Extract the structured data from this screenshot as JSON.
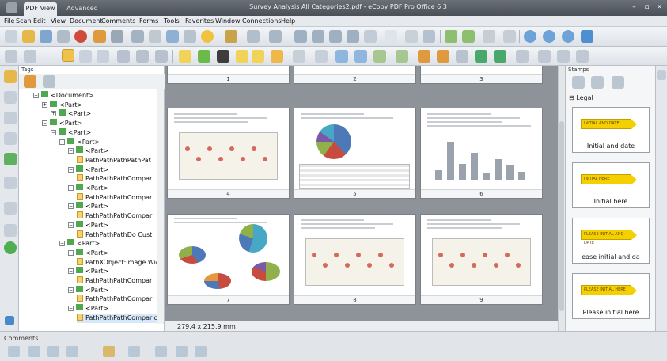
{
  "titlebar": {
    "tabs": [
      {
        "label": "PDF View"
      },
      {
        "label": "Advanced Edit"
      }
    ],
    "title": "Survey Analysis All Categories2.pdf - eCopy PDF Pro Office 6.3"
  },
  "menu": [
    "File",
    "Scan",
    "Edit",
    "View",
    "Document",
    "Comments",
    "Forms",
    "Tools",
    "Favorites",
    "Window",
    "Connections",
    "Help"
  ],
  "tags_panel": {
    "title": "Tags",
    "tree": [
      {
        "label": "<Document>",
        "depth": 0,
        "kind": "tag",
        "open": true
      },
      {
        "label": "<Part>",
        "depth": 1,
        "kind": "tag",
        "open": false
      },
      {
        "label": "<Part>",
        "depth": 2,
        "kind": "tag",
        "open": false
      },
      {
        "label": "<Part>",
        "depth": 1,
        "kind": "tag",
        "open": true
      },
      {
        "label": "<Part>",
        "depth": 2,
        "kind": "tag",
        "open": true
      },
      {
        "label": "<Part>",
        "depth": 3,
        "kind": "tag",
        "open": true
      },
      {
        "label": "<Part>",
        "depth": 4,
        "kind": "tag",
        "open": true
      },
      {
        "label": "PathPathPathPathPat",
        "depth": 5,
        "kind": "content"
      },
      {
        "label": "<Part>",
        "depth": 4,
        "kind": "tag",
        "open": true
      },
      {
        "label": "PathPathPathCompar",
        "depth": 5,
        "kind": "content"
      },
      {
        "label": "<Part>",
        "depth": 4,
        "kind": "tag",
        "open": true
      },
      {
        "label": "PathPathPathCompar",
        "depth": 5,
        "kind": "content"
      },
      {
        "label": "<Part>",
        "depth": 4,
        "kind": "tag",
        "open": true
      },
      {
        "label": "PathPathPathCompar",
        "depth": 5,
        "kind": "content"
      },
      {
        "label": "<Part>",
        "depth": 4,
        "kind": "tag",
        "open": true
      },
      {
        "label": "PathPathPathDo Cust",
        "depth": 5,
        "kind": "content"
      },
      {
        "label": "<Part>",
        "depth": 3,
        "kind": "tag",
        "open": true
      },
      {
        "label": "<Part>",
        "depth": 4,
        "kind": "tag",
        "open": true
      },
      {
        "label": "PathXObject:Image Width",
        "depth": 5,
        "kind": "content"
      },
      {
        "label": "<Part>",
        "depth": 4,
        "kind": "tag",
        "open": true
      },
      {
        "label": "PathPathPathCompar",
        "depth": 5,
        "kind": "content"
      },
      {
        "label": "<Part>",
        "depth": 4,
        "kind": "tag",
        "open": true
      },
      {
        "label": "PathPathPathCompar",
        "depth": 5,
        "kind": "content"
      },
      {
        "label": "<Part>",
        "depth": 4,
        "kind": "tag",
        "open": true
      },
      {
        "label": "PathPathPathComparions",
        "depth": 5,
        "kind": "content",
        "selected": true
      }
    ]
  },
  "pages": [
    {
      "num": "1",
      "kind": "text"
    },
    {
      "num": "2",
      "kind": "scatter"
    },
    {
      "num": "3",
      "kind": "scatter"
    },
    {
      "num": "4",
      "kind": "scatter"
    },
    {
      "num": "5",
      "kind": "pie"
    },
    {
      "num": "6",
      "kind": "bars"
    },
    {
      "num": "7",
      "kind": "multipie"
    },
    {
      "num": "8",
      "kind": "scatter"
    },
    {
      "num": "9",
      "kind": "scatter"
    }
  ],
  "page_size": "279.4 x 215.9 mm",
  "stamps_panel": {
    "title": "Stamps",
    "group": "Legal",
    "stamps": [
      {
        "badge": "INITIAL AND DATE",
        "label": "Initial and date"
      },
      {
        "badge": "INITIAL HERE",
        "label": "Initial here"
      },
      {
        "badge": "PLEASE INITIAL AND DATE",
        "label": "ease initial and da"
      },
      {
        "badge": "PLEASE INITIAL HERE",
        "label": "Please initial here"
      }
    ]
  },
  "comments_panel": {
    "title": "Comments"
  },
  "colors": {
    "accent": "#4fa84f",
    "pie": [
      "#4e79b8",
      "#c84b3f",
      "#8fb04a",
      "#7a5aa6",
      "#46a8c6",
      "#e8963a"
    ]
  }
}
